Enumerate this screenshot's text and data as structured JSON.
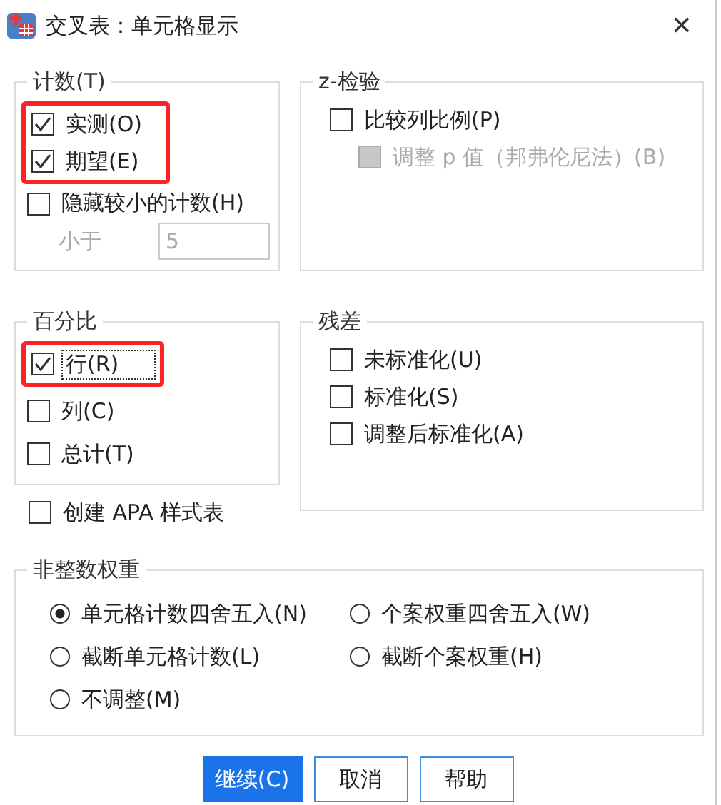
{
  "window": {
    "title": "交叉表：单元格显示",
    "close": "✕"
  },
  "counts": {
    "title": "计数(T)",
    "items": [
      {
        "label": "实测(O)",
        "checked": true,
        "highlighted": true
      },
      {
        "label": "期望(E)",
        "checked": true,
        "highlighted": true
      },
      {
        "label": "隐藏较小的计数(H)",
        "checked": false,
        "highlighted": false
      }
    ],
    "less_than": {
      "label": "小于",
      "value": "5",
      "disabled": true
    }
  },
  "z_test": {
    "title": "z-检验",
    "items": [
      {
        "label": "比较列比例(P)",
        "checked": false,
        "disabled": false
      },
      {
        "label": "调整 p 值（邦弗伦尼法）(B)",
        "checked": false,
        "disabled": true
      }
    ]
  },
  "percentages": {
    "title": "百分比",
    "items": [
      {
        "label": "行(R)",
        "checked": true,
        "highlighted": true,
        "focused": true
      },
      {
        "label": "列(C)",
        "checked": false,
        "highlighted": false,
        "focused": false
      },
      {
        "label": "总计(T)",
        "checked": false,
        "highlighted": false,
        "focused": false
      }
    ]
  },
  "apa": {
    "label": "创建 APA 样式表",
    "checked": false
  },
  "residuals": {
    "title": "残差",
    "items": [
      {
        "label": "未标准化(U)",
        "checked": false
      },
      {
        "label": "标准化(S)",
        "checked": false
      },
      {
        "label": "调整后标准化(A)",
        "checked": false
      }
    ]
  },
  "noninteger_weights": {
    "title": "非整数权重",
    "options": [
      {
        "label": "单元格计数四舍五入(N)",
        "selected": true
      },
      {
        "label": "个案权重四舍五入(W)",
        "selected": false
      },
      {
        "label": "截断单元格计数(L)",
        "selected": false
      },
      {
        "label": "截断个案权重(H)",
        "selected": false
      },
      {
        "label": "不调整(M)",
        "selected": false
      }
    ]
  },
  "buttons": [
    {
      "label": "继续(C)",
      "primary": true
    },
    {
      "label": "取消",
      "primary": false
    },
    {
      "label": "帮助",
      "primary": false
    }
  ]
}
